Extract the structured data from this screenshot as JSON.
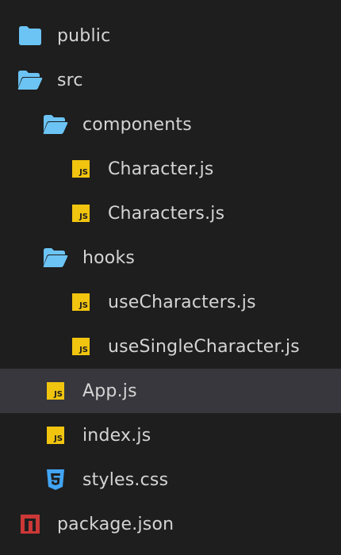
{
  "explorer": {
    "items": [
      {
        "label": "public",
        "icon": "folder-closed-icon"
      },
      {
        "label": "src",
        "icon": "folder-open-icon"
      },
      {
        "label": "components",
        "icon": "folder-open-icon"
      },
      {
        "label": "Character.js",
        "icon": "javascript-file-icon",
        "badge": "JS"
      },
      {
        "label": "Characters.js",
        "icon": "javascript-file-icon",
        "badge": "JS"
      },
      {
        "label": "hooks",
        "icon": "folder-open-icon"
      },
      {
        "label": "useCharacters.js",
        "icon": "javascript-file-icon",
        "badge": "JS"
      },
      {
        "label": "useSingleCharacter.js",
        "icon": "javascript-file-icon",
        "badge": "JS"
      },
      {
        "label": "App.js",
        "icon": "javascript-file-icon",
        "badge": "JS",
        "selected": true
      },
      {
        "label": "index.js",
        "icon": "javascript-file-icon",
        "badge": "JS"
      },
      {
        "label": "styles.css",
        "icon": "css-file-icon"
      },
      {
        "label": "package.json",
        "icon": "npm-package-icon"
      }
    ]
  },
  "colors": {
    "background": "#1e1e1e",
    "selected_row": "#37373d",
    "text": "#d4d4d4",
    "folder": "#6cc4f5",
    "js_badge": "#f1c40f",
    "css_icon": "#42a5f5",
    "npm_icon": "#cb3837"
  }
}
